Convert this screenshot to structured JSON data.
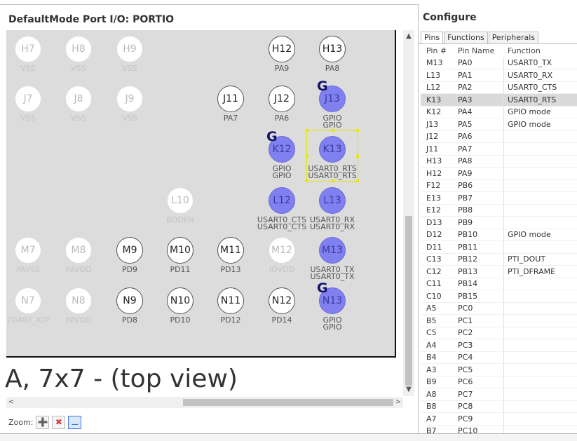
{
  "left": {
    "title": "DefaultMode Port I/O: PORTIO",
    "big_text": "A, 7x7 - (top view)",
    "zoom_label": "Zoom:"
  },
  "pins": [
    {
      "id": "H7",
      "label": "VSS",
      "style": "dim"
    },
    {
      "id": "H8",
      "label": "VSS",
      "style": "dim"
    },
    {
      "id": "H9",
      "label": "VSS",
      "style": "dim"
    },
    {
      "id": "H12",
      "label": "PA9",
      "style": "normal"
    },
    {
      "id": "H13",
      "label": "PA8",
      "style": "normal"
    },
    {
      "id": "J7",
      "label": "VSS",
      "style": "dim"
    },
    {
      "id": "J8",
      "label": "VSS",
      "style": "dim"
    },
    {
      "id": "J9",
      "label": "VSS",
      "style": "dim"
    },
    {
      "id": "J11",
      "label": "PA7",
      "style": "normal"
    },
    {
      "id": "J12",
      "label": "PA6",
      "style": "normal"
    },
    {
      "id": "J13",
      "label": "GPIO",
      "label2": "GPIO",
      "style": "active",
      "g": "G"
    },
    {
      "id": "K12",
      "label": "GPIO",
      "label2": "GPIO",
      "style": "active",
      "g": "G"
    },
    {
      "id": "K13",
      "label": "USART0_RTS",
      "label2": "USART0_RTS",
      "style": "active"
    },
    {
      "id": "L10",
      "label": "BODEN",
      "style": "dim"
    },
    {
      "id": "L12",
      "label": "USART0_CTS",
      "label2": "USART0_CTS",
      "style": "active"
    },
    {
      "id": "L13",
      "label": "USART0_RX",
      "label2": "USART0_RX",
      "style": "active"
    },
    {
      "id": "M7",
      "label": "PAVSS",
      "style": "dim"
    },
    {
      "id": "M8",
      "label": "PAVDD",
      "style": "dim"
    },
    {
      "id": "M9",
      "label": "PD9",
      "style": "normal"
    },
    {
      "id": "M10",
      "label": "PD11",
      "style": "normal"
    },
    {
      "id": "M11",
      "label": "PD13",
      "style": "normal"
    },
    {
      "id": "M12",
      "label": "IOVDD",
      "style": "dim"
    },
    {
      "id": "M13",
      "label": "USART0_TX",
      "label2": "USART0_TX",
      "style": "active"
    },
    {
      "id": "N7",
      "label": "2G4RF_IOP",
      "style": "dim"
    },
    {
      "id": "N8",
      "label": "PAVDD",
      "style": "dim"
    },
    {
      "id": "N9",
      "label": "PD8",
      "style": "normal"
    },
    {
      "id": "N10",
      "label": "PD10",
      "style": "normal"
    },
    {
      "id": "N11",
      "label": "PD12",
      "style": "normal"
    },
    {
      "id": "N12",
      "label": "PD14",
      "style": "normal"
    },
    {
      "id": "N13",
      "label": "GPIO",
      "label2": "GPIO",
      "style": "active",
      "g": "G"
    }
  ],
  "cut_label": "DN",
  "configure": {
    "title": "Configure",
    "tabs": [
      "Pins",
      "Functions",
      "Peripherals"
    ],
    "columns": [
      "Pin #",
      "Pin Name",
      "Function"
    ],
    "rows": [
      [
        "M13",
        "PA0",
        "USART0_TX"
      ],
      [
        "L13",
        "PA1",
        "USART0_RX"
      ],
      [
        "L12",
        "PA2",
        "USART0_CTS"
      ],
      [
        "K13",
        "PA3",
        "USART0_RTS"
      ],
      [
        "K12",
        "PA4",
        "GPIO mode"
      ],
      [
        "J13",
        "PA5",
        "GPIO mode"
      ],
      [
        "J12",
        "PA6",
        ""
      ],
      [
        "J11",
        "PA7",
        ""
      ],
      [
        "H13",
        "PA8",
        ""
      ],
      [
        "H12",
        "PA9",
        ""
      ],
      [
        "F12",
        "PB6",
        ""
      ],
      [
        "E13",
        "PB7",
        ""
      ],
      [
        "E12",
        "PB8",
        ""
      ],
      [
        "D13",
        "PB9",
        ""
      ],
      [
        "D12",
        "PB10",
        "GPIO mode"
      ],
      [
        "D11",
        "PB11",
        ""
      ],
      [
        "C13",
        "PB12",
        "PTI_DOUT"
      ],
      [
        "C12",
        "PB13",
        "PTI_DFRAME"
      ],
      [
        "C11",
        "PB14",
        ""
      ],
      [
        "C10",
        "PB15",
        ""
      ],
      [
        "A5",
        "PC0",
        ""
      ],
      [
        "B5",
        "PC1",
        ""
      ],
      [
        "C5",
        "PC2",
        ""
      ],
      [
        "A4",
        "PC3",
        ""
      ],
      [
        "B4",
        "PC4",
        ""
      ],
      [
        "A3",
        "PC5",
        ""
      ],
      [
        "B9",
        "PC6",
        ""
      ],
      [
        "A8",
        "PC7",
        ""
      ],
      [
        "B8",
        "PC8",
        ""
      ],
      [
        "A7",
        "PC9",
        ""
      ],
      [
        "B7",
        "PC10",
        ""
      ]
    ],
    "selected_row": 3
  }
}
